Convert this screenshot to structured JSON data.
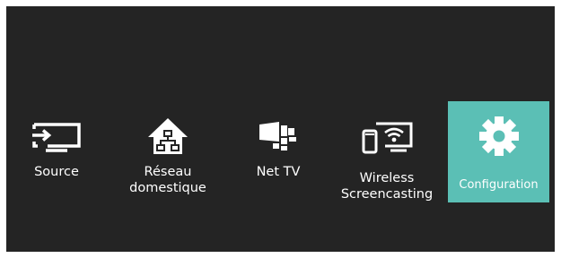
{
  "colors": {
    "background": "#242424",
    "selected_tile": "#5bbfb5",
    "icon": "#ffffff",
    "text": "#ffffff"
  },
  "menu": {
    "selected_index": 4,
    "items": [
      {
        "label": "Source",
        "icon": "source-input-icon"
      },
      {
        "label_line1": "Réseau",
        "label_line2": "domestique",
        "icon": "home-network-icon"
      },
      {
        "label": "Net TV",
        "icon": "net-tv-icon"
      },
      {
        "label_line1": "Wireless",
        "label_line2": "Screencasting",
        "icon": "wireless-screencasting-icon"
      },
      {
        "label": "Configuration",
        "icon": "gear-icon"
      }
    ]
  }
}
